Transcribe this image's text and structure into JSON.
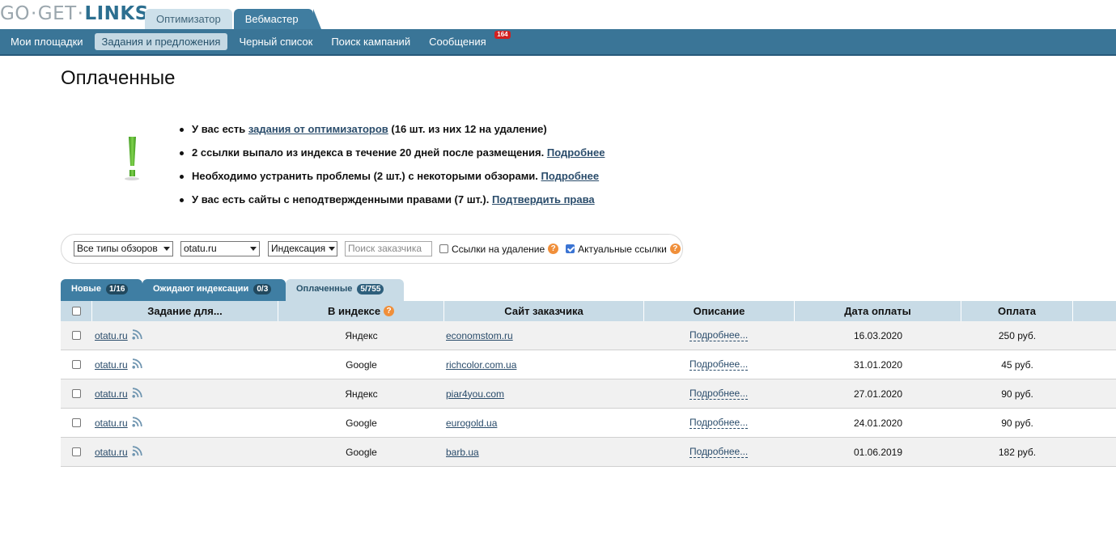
{
  "logo": {
    "part1": "GO",
    "dot1": "·",
    "part2": "GET",
    "dot2": "·",
    "part3": "LINKS"
  },
  "role_tabs": [
    "Оптимизатор",
    "Вебмастер"
  ],
  "nav": {
    "items": [
      "Мои площадки",
      "Задания и предложения",
      "Черный список",
      "Поиск кампаний",
      "Сообщения"
    ],
    "messages_badge": "164"
  },
  "page_title": "Оплаченные",
  "notices": [
    {
      "pre": "У вас есть ",
      "link": "задания от оптимизаторов",
      "post": " (16 шт. из них 12 на удаление)"
    },
    {
      "pre": "2 ссылки выпало из индекса в течение 20 дней после размещения. ",
      "link": "Подробнее",
      "post": ""
    },
    {
      "pre": "Необходимо устранить проблемы (2 шт.) с некоторыми обзорами. ",
      "link": "Подробнее",
      "post": ""
    },
    {
      "pre": "У вас есть сайты с неподтвержденными правами (7 шт.). ",
      "link": "Подтвердить права",
      "post": ""
    }
  ],
  "filter": {
    "review_type": "Все типы обзоров",
    "site": "otatu.ru",
    "indexing": "Индексация",
    "search_placeholder": "Поиск заказчика",
    "delete_links_label": "Ссылки на удаление",
    "actual_links_label": "Актуальные ссылки",
    "help_glyph": "?"
  },
  "tabs": [
    {
      "label": "Новые",
      "count": "1/16"
    },
    {
      "label": "Ожидают индексации",
      "count": "0/3"
    },
    {
      "label": "Оплаченные",
      "count": "5/755"
    }
  ],
  "table": {
    "headers": [
      "Задание для...",
      "В индексе",
      "Сайт заказчика",
      "Описание",
      "Дата оплаты",
      "Оплата"
    ],
    "rows": [
      {
        "site": "otatu.ru",
        "index": "Яндекс",
        "customer": "economstom.ru",
        "desc": "Подробнее...",
        "date": "16.03.2020",
        "pay": "250 руб."
      },
      {
        "site": "otatu.ru",
        "index": "Google",
        "customer": "richcolor.com.ua",
        "desc": "Подробнее...",
        "date": "31.01.2020",
        "pay": "45 руб."
      },
      {
        "site": "otatu.ru",
        "index": "Яндекс",
        "customer": "piar4you.com",
        "desc": "Подробнее...",
        "date": "27.01.2020",
        "pay": "90 руб."
      },
      {
        "site": "otatu.ru",
        "index": "Google",
        "customer": "eurogold.ua",
        "desc": "Подробнее...",
        "date": "24.01.2020",
        "pay": "90 руб."
      },
      {
        "site": "otatu.ru",
        "index": "Google",
        "customer": "barb.ua",
        "desc": "Подробнее...",
        "date": "01.06.2019",
        "pay": "182 руб."
      }
    ]
  },
  "colors": {
    "nav": "#3a7597",
    "tab": "#3f7ea3",
    "header_row": "#c8dbe6",
    "exclamation": "#58b82b",
    "help": "#f08f3a",
    "badge": "#d22020"
  }
}
